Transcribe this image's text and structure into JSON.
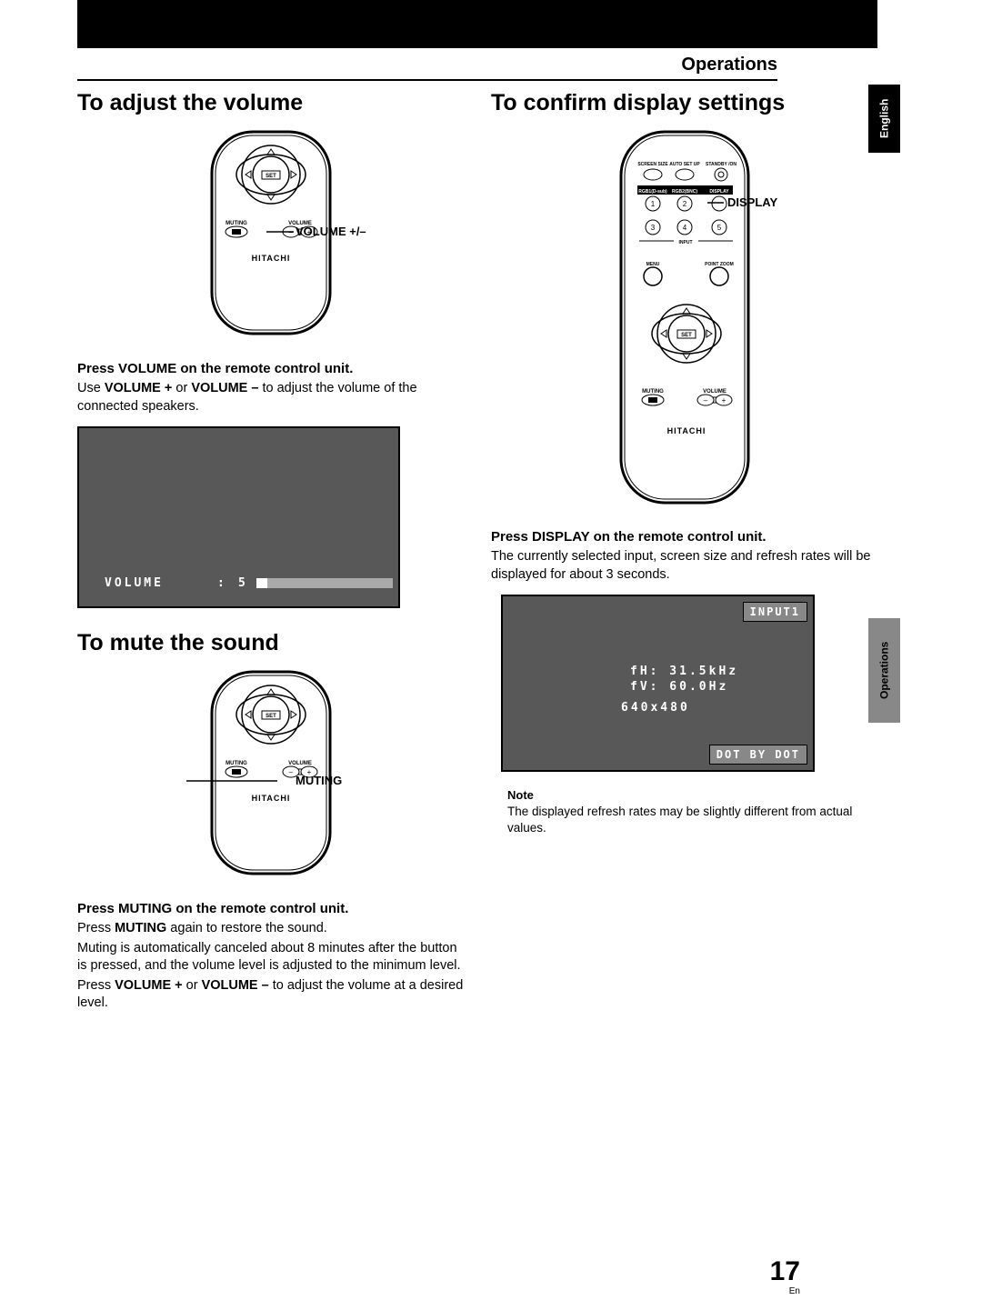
{
  "header": {
    "section": "Operations"
  },
  "tabs": {
    "lang": "English",
    "section": "Operations"
  },
  "page": {
    "num": "17",
    "lang": "En"
  },
  "left": {
    "h1": "To adjust the volume",
    "volcallout": "VOLUME +/–",
    "brand": "HITACHI",
    "set": "SET",
    "muting_lbl": "MUTING",
    "volume_lbl": "VOLUME",
    "inst1_h": "Press VOLUME on the remote control unit.",
    "inst1_p1a": "Use ",
    "inst1_p1b": "VOLUME +",
    "inst1_p1c": " or ",
    "inst1_p1d": "VOLUME –",
    "inst1_p1e": " to adjust the volume of the connected speakers.",
    "osd_vol_label": "VOLUME",
    "osd_vol_sep": ":",
    "osd_vol_val": "5",
    "h2": "To mute the sound",
    "mutecallout": "MUTING",
    "inst2_h": "Press MUTING on the remote control unit.",
    "inst2_p1a": "Press ",
    "inst2_p1b": "MUTING",
    "inst2_p1c": " again to restore the sound.",
    "inst2_p2": "Muting is automatically canceled about 8 minutes after the button is pressed, and the volume level is adjusted to the minimum level.",
    "inst2_p3a": "Press ",
    "inst2_p3b": "VOLUME +",
    "inst2_p3c": " or ",
    "inst2_p3d": "VOLUME –",
    "inst2_p3e": " to adjust the volume at a desired level."
  },
  "right": {
    "h1": "To confirm display settings",
    "dispcallout": "DISPLAY",
    "brand": "HITACHI",
    "set": "SET",
    "screen_size": "SCREEN SIZE",
    "auto_setup": "AUTO SET UP",
    "standby": "STANDBY /ON",
    "rgb1": "RGB1(D-sub)",
    "rgb2": "RGB2(BNC)",
    "display": "DISPLAY",
    "input": "INPUT",
    "menu": "MENU",
    "pointzoom": "POINT ZOOM",
    "muting_lbl": "MUTING",
    "volume_lbl": "VOLUME",
    "inst1_h": "Press DISPLAY on the remote control unit.",
    "inst1_p": "The currently selected input, screen size and refresh rates will be displayed for about 3 seconds.",
    "osd_input": "INPUT1",
    "osd_fh": "fH: 31.5kHz",
    "osd_fv": "fV: 60.0Hz",
    "osd_res": "640x480",
    "osd_mode": "DOT BY DOT",
    "note_h": "Note",
    "note_p": "The displayed refresh rates may be slightly different from actual values."
  }
}
